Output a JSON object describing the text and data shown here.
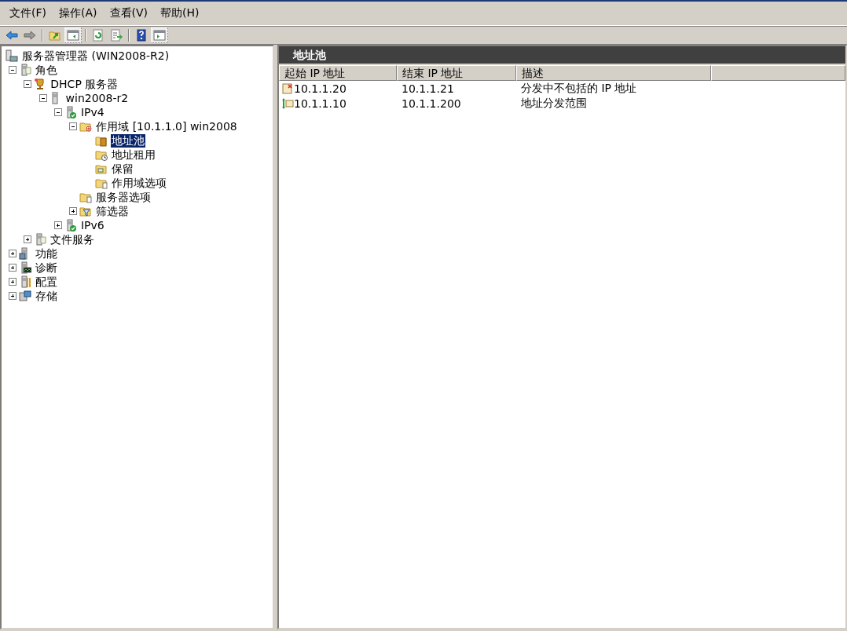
{
  "menu": [
    {
      "label": "文件(F)"
    },
    {
      "label": "操作(A)"
    },
    {
      "label": "查看(V)"
    },
    {
      "label": "帮助(H)"
    }
  ],
  "toolbar": [
    {
      "kind": "back",
      "pressed": false
    },
    {
      "kind": "forward",
      "pressed": false
    },
    {
      "kind": "separator"
    },
    {
      "kind": "up",
      "pressed": false
    },
    {
      "kind": "tree-pane",
      "pressed": true
    },
    {
      "kind": "separator"
    },
    {
      "kind": "refresh",
      "pressed": false
    },
    {
      "kind": "export",
      "pressed": false
    },
    {
      "kind": "separator"
    },
    {
      "kind": "help",
      "pressed": false
    },
    {
      "kind": "action-pane",
      "pressed": true
    }
  ],
  "tree": [
    {
      "label": "服务器管理器 (WIN2008-R2)",
      "kind": "console",
      "selected": false,
      "children": [
        {
          "label": "角色",
          "kind": "roles",
          "expanded": true,
          "selected": false,
          "children": [
            {
              "label": "DHCP 服务器",
              "kind": "trophy",
              "expanded": true,
              "selected": false,
              "children": [
                {
                  "label": "win2008-r2",
                  "kind": "server",
                  "expanded": true,
                  "selected": false,
                  "children": [
                    {
                      "label": "IPv4",
                      "kind": "server-check",
                      "expanded": true,
                      "selected": false,
                      "children": [
                        {
                          "label": "作用域 [10.1.1.0] win2008",
                          "kind": "folder-scope",
                          "expanded": true,
                          "selected": false,
                          "children": [
                            {
                              "label": "地址池",
                              "kind": "folder-pool",
                              "selected": true
                            },
                            {
                              "label": "地址租用",
                              "kind": "folder-clock",
                              "selected": false
                            },
                            {
                              "label": "保留",
                              "kind": "folder-grid",
                              "selected": false
                            },
                            {
                              "label": "作用域选项",
                              "kind": "folder-doc",
                              "selected": false
                            }
                          ]
                        },
                        {
                          "label": "服务器选项",
                          "kind": "folder-doc",
                          "selected": false
                        },
                        {
                          "label": "筛选器",
                          "kind": "folder-filter",
                          "expanded": false,
                          "selected": false
                        }
                      ]
                    },
                    {
                      "label": "IPv6",
                      "kind": "server-check",
                      "expanded": false,
                      "selected": false
                    }
                  ]
                }
              ]
            },
            {
              "label": "文件服务",
              "kind": "roles",
              "expanded": false,
              "selected": false
            }
          ]
        },
        {
          "label": "功能",
          "kind": "features",
          "expanded": false,
          "selected": false
        },
        {
          "label": "诊断",
          "kind": "diagnostics",
          "expanded": false,
          "selected": false
        },
        {
          "label": "配置",
          "kind": "config",
          "expanded": false,
          "selected": false
        },
        {
          "label": "存储",
          "kind": "storage",
          "expanded": false,
          "selected": false
        }
      ]
    }
  ],
  "pane_title": "地址池",
  "table": {
    "columns": [
      "起始 IP 地址",
      "结束 IP 地址",
      "描述"
    ],
    "rows": [
      {
        "kind": "excluded",
        "cells": [
          "10.1.1.20",
          "10.1.1.21",
          "分发中不包括的 IP 地址"
        ]
      },
      {
        "kind": "range",
        "cells": [
          "10.1.1.10",
          "10.1.1.200",
          "地址分发范围"
        ]
      }
    ]
  }
}
